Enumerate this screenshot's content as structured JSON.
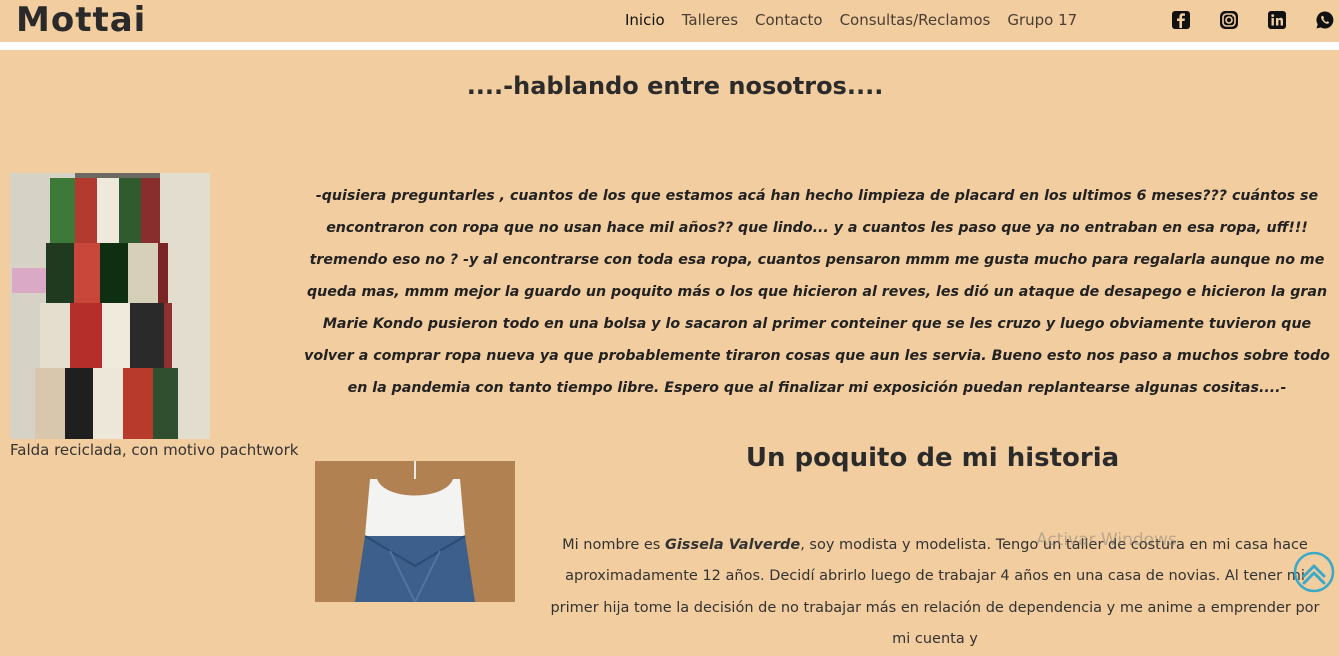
{
  "header": {
    "brand": "Mottai",
    "nav": [
      "Inicio",
      "Talleres",
      "Contacto",
      "Consultas/Reclamos",
      "Grupo 17"
    ],
    "social_icons": [
      "facebook-icon",
      "instagram-icon",
      "linkedin-icon",
      "whatsapp-icon"
    ]
  },
  "main": {
    "heading": "....-hablando entre nosotros....",
    "intro": "-quisiera preguntarles , cuantos de los que estamos acá han hecho limpieza de placard en los ultimos 6 meses??? cuántos se encontraron con ropa que no usan hace mil años?? que lindo... y a cuantos les paso que ya no entraban en esa ropa, uff!!! tremendo eso no ? -y al encontrarse con toda esa ropa, cuantos pensaron mmm me gusta mucho para regalarla aunque no me queda mas, mmm mejor la guardo un poquito más o los que hicieron al reves, les dió un ataque de desapego e hicieron la gran Marie Kondo pusieron todo en una bolsa y lo sacaron al primer conteiner que se les cruzo y luego obviamente tuvieron que volver a comprar ropa nueva ya que probablemente tiraron cosas que aun les servia. Bueno esto nos paso a muchos sobre todo en la pandemia con tanto tiempo libre. Espero que al finalizar mi exposición puedan replantearse algunas cositas....-",
    "photo_caption": "Falda reciclada, con motivo pachtwork",
    "history_heading": "Un poquito de mi historia",
    "bio_prefix": "Mi nombre es ",
    "bio_name": "Gissela Valverde",
    "bio_text": ", soy modista y modelista. Tengo un taller de costura en mi casa hace aproximadamente 12 años. Decidí abrirlo luego de trabajar 4 años en una casa de novias. Al tener mi primer hija tome la decisión de no trabajar más en relación de dependencia y me anime a emprender por mi cuenta y"
  },
  "overlay": {
    "watermark": "Activar Windows"
  },
  "colors": {
    "background": "#f2cd9f",
    "divider": "#ffffff",
    "text": "#222222"
  }
}
